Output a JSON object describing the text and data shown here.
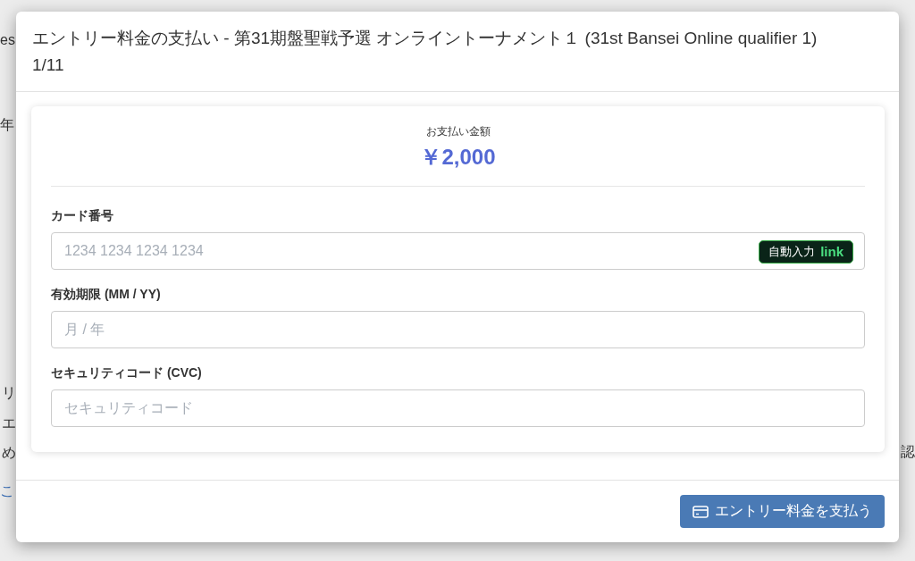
{
  "background_page": {
    "left_fragments": [
      {
        "text": "es",
        "kind": "text"
      },
      {
        "text": "年",
        "kind": "text"
      },
      {
        "text": "リ",
        "kind": "text"
      },
      {
        "text": "エ",
        "kind": "text"
      },
      {
        "text": "め",
        "kind": "text"
      },
      {
        "text": "こ",
        "kind": "link"
      }
    ],
    "right_fragments": [
      {
        "text": "認"
      }
    ]
  },
  "dialog": {
    "title": "エントリー料金の支払い - 第31期盤聖戦予選 オンライントーナメント１ (31st Bansei Online qualifier 1) 1/11",
    "amount_label": "お支払い金額",
    "amount": "￥2,000",
    "fields": [
      {
        "label": "カード番号",
        "placeholder": "1234 1234 1234 1234",
        "autofill": {
          "text": "自動入力",
          "brand": "link"
        }
      },
      {
        "label": "有効期限 (MM / YY)",
        "placeholder": "月 / 年"
      },
      {
        "label": "セキュリティコード (CVC)",
        "placeholder": "セキュリティコード"
      }
    ],
    "pay_button": "エントリー料金を支払う"
  }
}
